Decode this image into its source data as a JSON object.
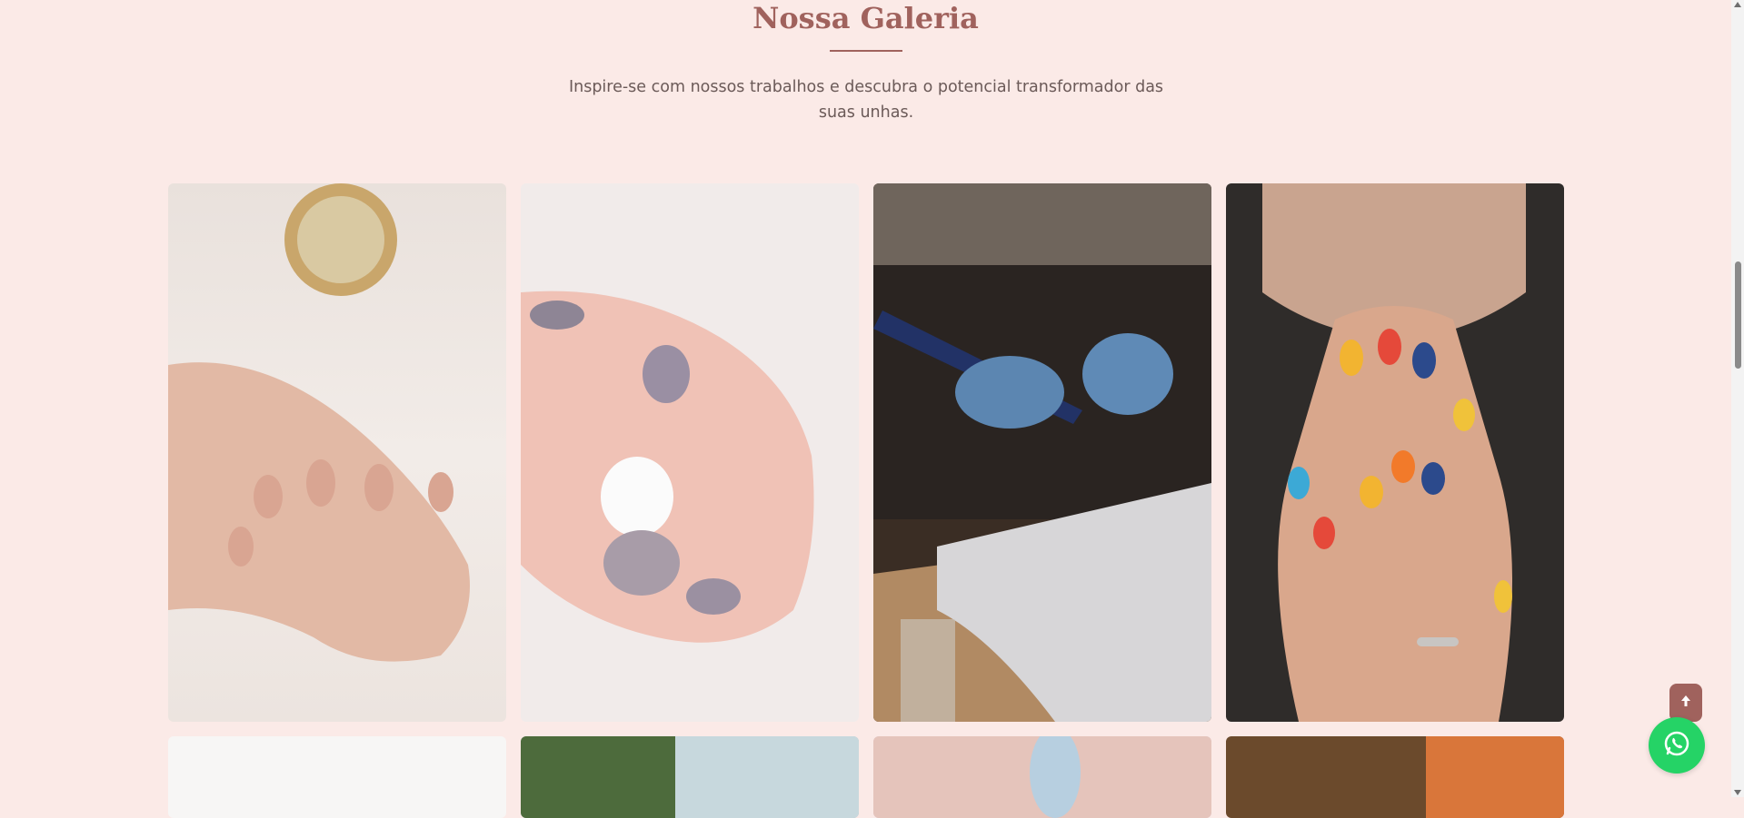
{
  "gallery": {
    "title": "Nossa Galeria",
    "subtitle": "Inspire-se com nossos trabalhos e descubra o potencial transformador das suas unhas."
  },
  "colors": {
    "background": "#fbeae7",
    "accent": "#a0625d",
    "whatsapp": "#25d366"
  },
  "icons": {
    "back_to_top": "arrow-up-icon",
    "whatsapp": "whatsapp-icon"
  }
}
